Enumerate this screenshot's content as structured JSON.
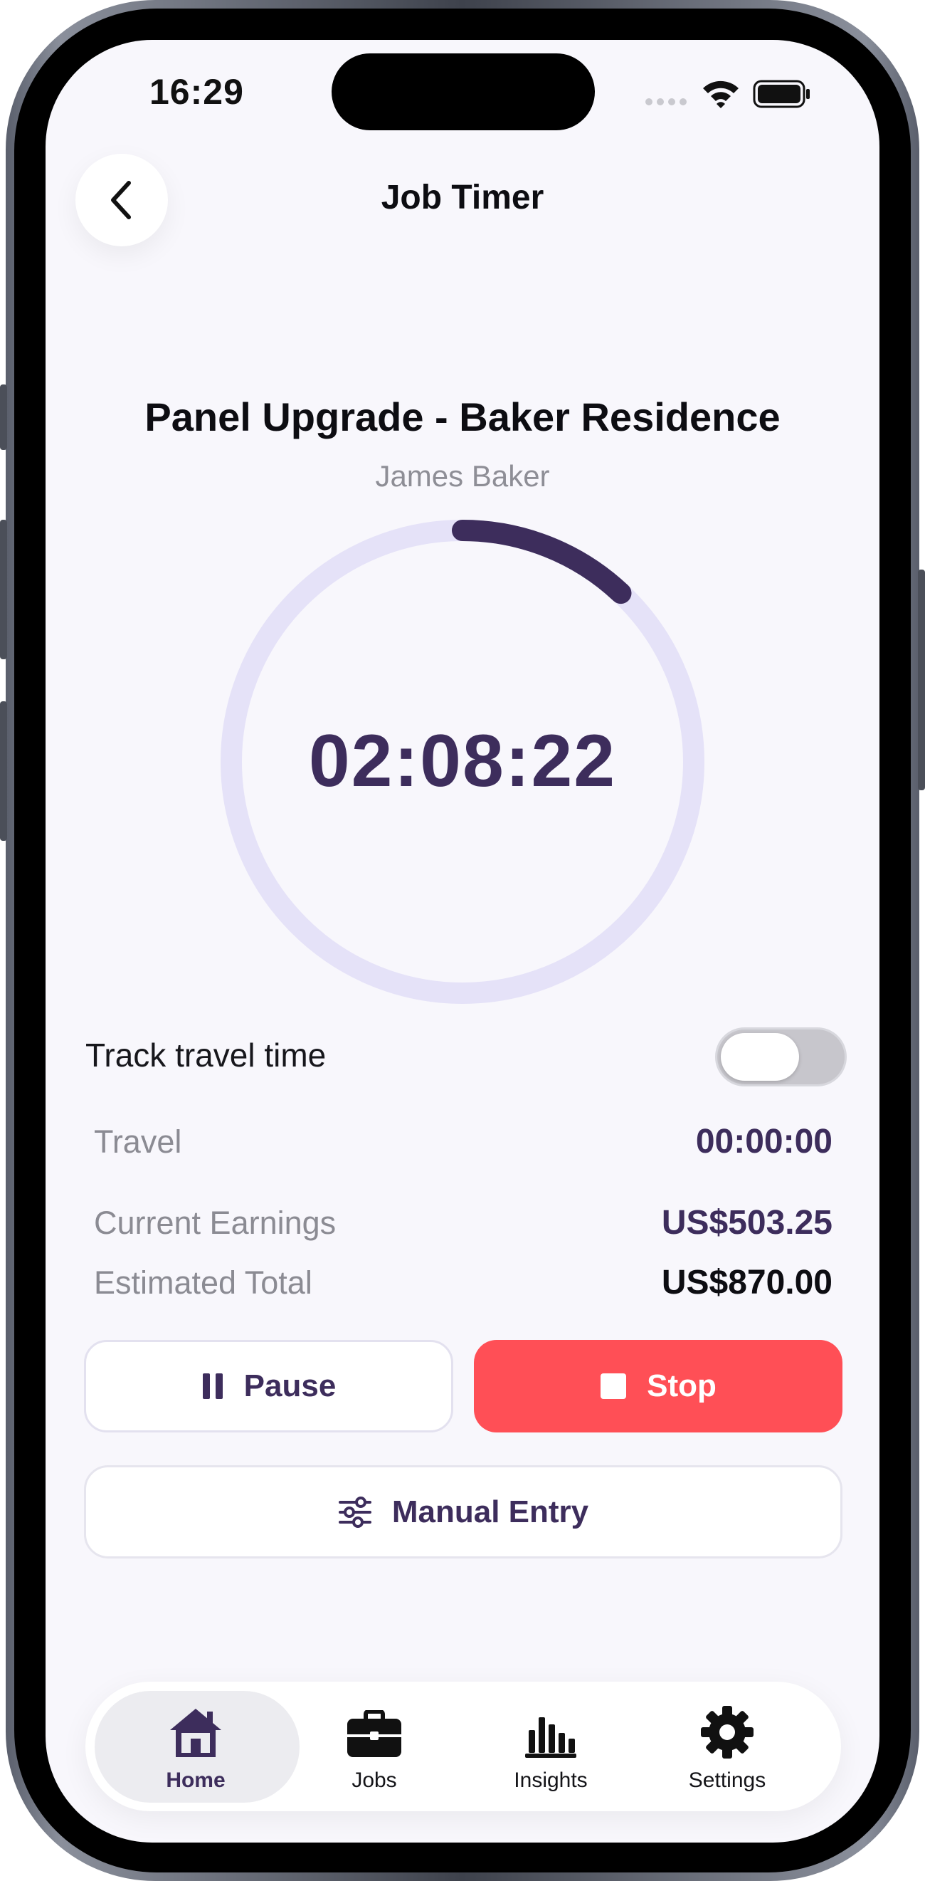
{
  "status_bar": {
    "time": "16:29"
  },
  "header": {
    "title": "Job Timer"
  },
  "job": {
    "title": "Panel Upgrade - Baker Residence",
    "client": "James Baker",
    "elapsed": "02:08:22",
    "progress_fraction": 0.12
  },
  "travel": {
    "toggle_label": "Track travel time",
    "toggle_on": false
  },
  "stats": [
    {
      "label": "Travel",
      "value": "00:00:00",
      "color": "#3d2d5c"
    },
    {
      "label": "Current Earnings",
      "value": "US$503.25",
      "color": "#3d2d5c"
    },
    {
      "label": "Estimated Total",
      "value": "US$870.00",
      "color": "#0d0d12"
    }
  ],
  "actions": {
    "pause": "Pause",
    "stop": "Stop",
    "manual": "Manual Entry"
  },
  "tabs": [
    {
      "label": "Home",
      "icon": "home-icon",
      "active": true
    },
    {
      "label": "Jobs",
      "icon": "briefcase-icon",
      "active": false
    },
    {
      "label": "Insights",
      "icon": "bar-chart-icon",
      "active": false
    },
    {
      "label": "Settings",
      "icon": "gear-icon",
      "active": false
    }
  ],
  "colors": {
    "accent": "#3d2d5c",
    "ring_track": "#e5e2f8",
    "danger": "#ff4f56",
    "background": "#f8f7fc"
  }
}
